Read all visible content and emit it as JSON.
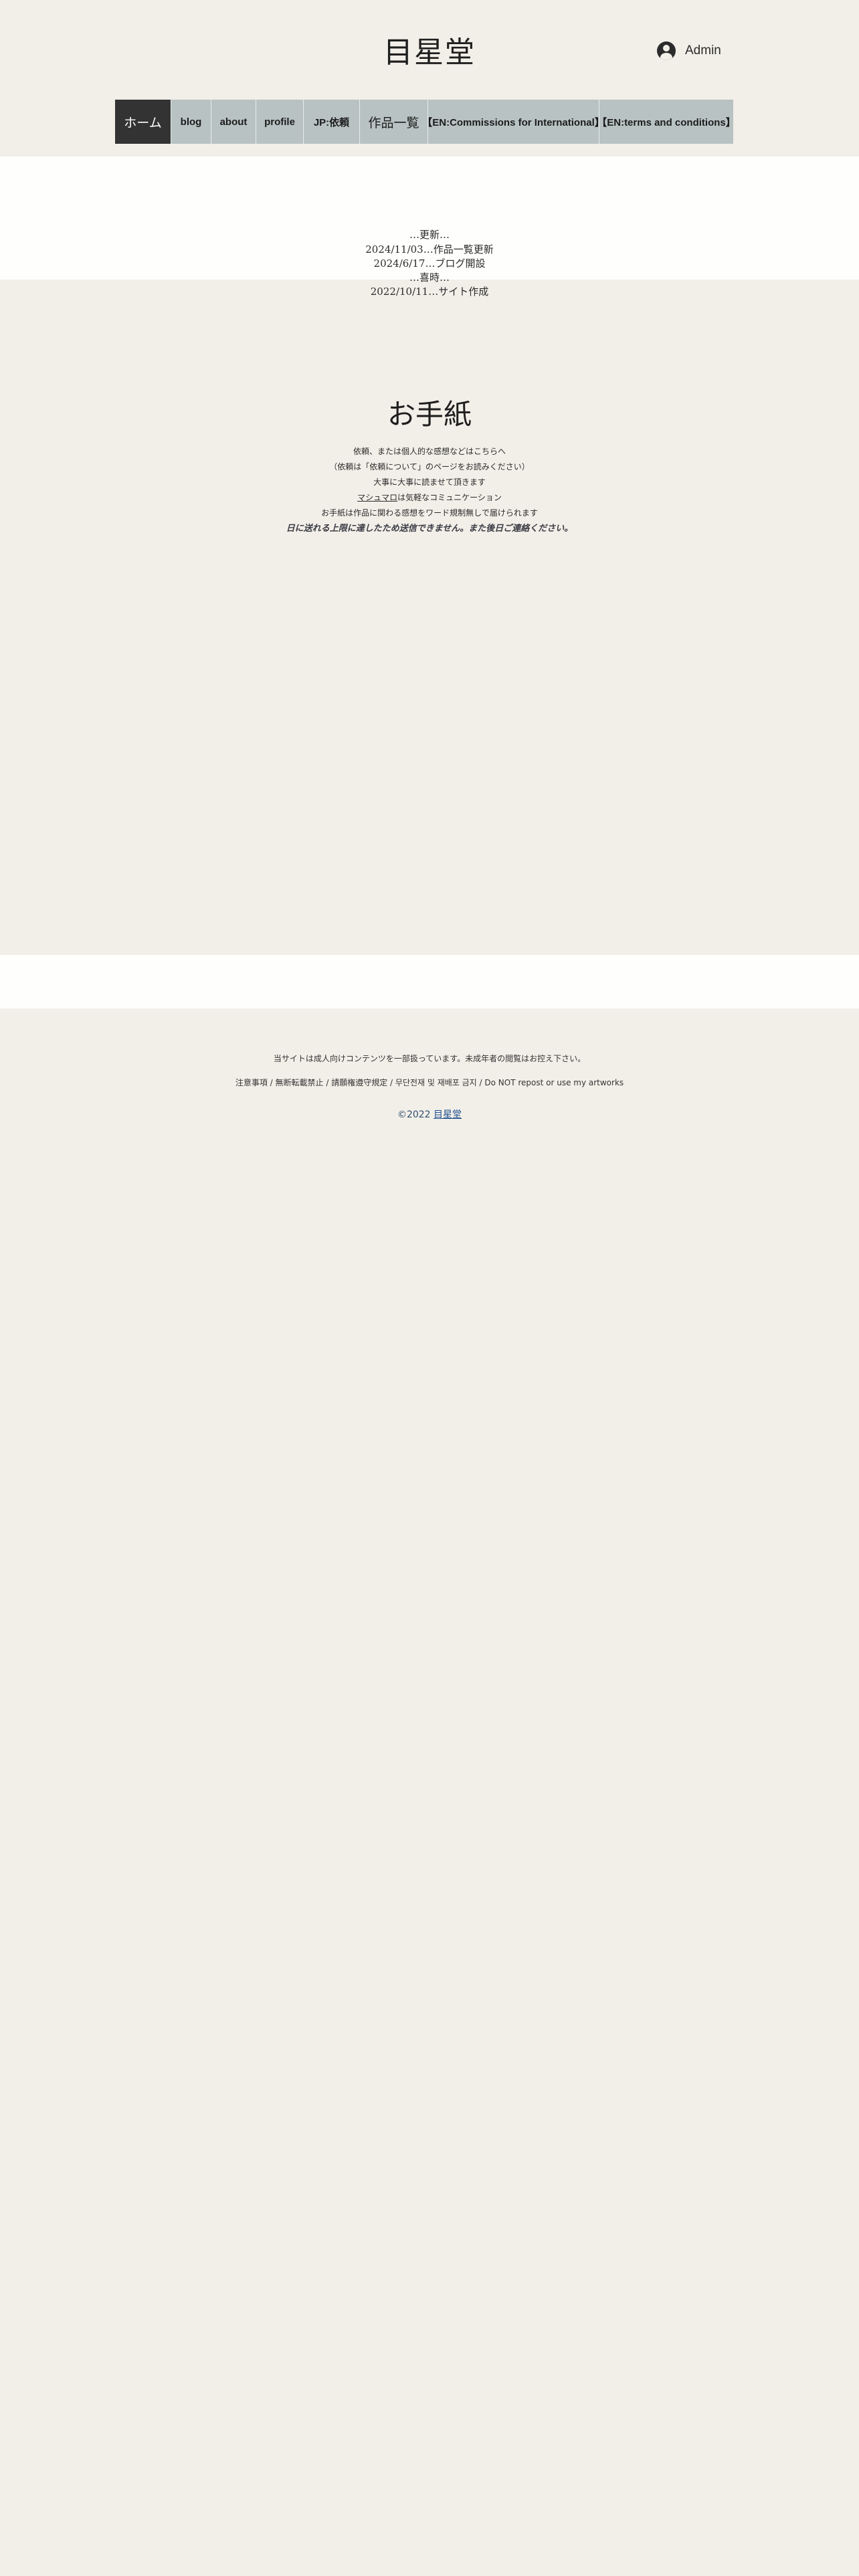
{
  "header": {
    "site_title": "目星堂",
    "admin_label": "Admin"
  },
  "nav": {
    "items": [
      {
        "label": "ホーム",
        "active": true
      },
      {
        "label": "blog"
      },
      {
        "label": "about"
      },
      {
        "label": "profile"
      },
      {
        "label": "JP:依頼"
      },
      {
        "label": "作品一覧"
      },
      {
        "label": "【EN:Commissions for International】"
      },
      {
        "label": "【EN:terms and conditions】"
      }
    ]
  },
  "updates": {
    "lines": [
      "…更新…",
      "2024/11/03…作品一覧更新",
      "2024/6/17…ブログ開設",
      "…喜時…",
      "2022/10/11…サイト作成"
    ]
  },
  "letter": {
    "title": "お手紙",
    "line1": "依頼、または個人的な感想などはこちらへ",
    "line2": "（依頼は「依頼について」のページをお読みください）",
    "line3": "大事に大事に読ませて頂きます",
    "link_text": "マシュマロ",
    "line4_suffix": "は気軽なコミュニケーション",
    "line5": "お手紙は作品に関わる感想をワード規制無しで届けられます",
    "warning": "日に送れる上限に達したため送信できません。また後日ご連絡ください。"
  },
  "footer": {
    "notice": "当サイトは成人向けコンテンツを一部扱っています。未成年者の閲覧はお控え下さい。",
    "notice2": "注意事項 / 無断転載禁止 / 請願権遵守規定 / 무단전재 및 재배포 금지 / Do NOT repost or use my artworks",
    "copyright_prefix": "©2022 ",
    "copyright_link": "目星堂"
  }
}
